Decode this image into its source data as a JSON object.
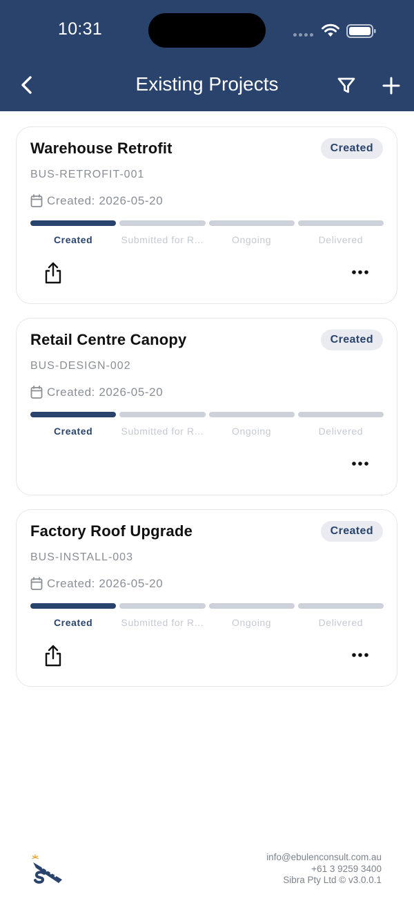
{
  "status_bar": {
    "time": "10:31"
  },
  "header": {
    "title": "Existing Projects",
    "back_icon": "chevron-left-icon",
    "filter_icon": "filter-icon",
    "add_icon": "plus-icon"
  },
  "stages": [
    "Created",
    "Submitted for R...",
    "Ongoing",
    "Delivered"
  ],
  "projects": [
    {
      "name": "Warehouse Retrofit",
      "status": "Created",
      "code": "BUS-RETROFIT-001",
      "created": "Created: 2026-05-20",
      "current_stage": 1,
      "has_share": true
    },
    {
      "name": "Retail Centre Canopy",
      "status": "Created",
      "code": "BUS-DESIGN-002",
      "created": "Created: 2026-05-20",
      "current_stage": 1,
      "has_share": false
    },
    {
      "name": "Factory Roof Upgrade",
      "status": "Created",
      "code": "BUS-INSTALL-003",
      "created": "Created: 2026-05-20",
      "current_stage": 1,
      "has_share": true
    }
  ],
  "footer": {
    "email": "info@ebulenconsult.com.au",
    "phone": "+61 3 9259 3400",
    "copyright": "Sibra Pty Ltd © v3.0.0.1"
  },
  "colors": {
    "brand": "#29436d",
    "pill_bg": "#e9ebf0",
    "inactive_segment": "#cdd1da",
    "muted_text": "#8a8e95"
  }
}
